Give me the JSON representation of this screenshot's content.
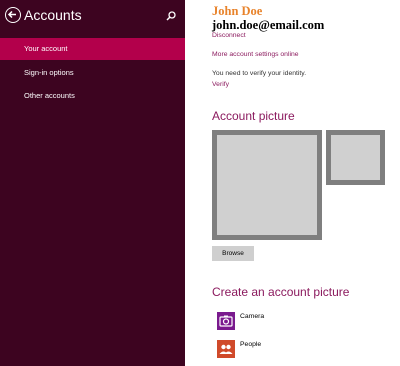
{
  "header": {
    "title": "Accounts"
  },
  "sidebar": {
    "items": [
      {
        "label": "Your account",
        "active": true
      },
      {
        "label": "Sign-in options",
        "active": false
      },
      {
        "label": "Other accounts",
        "active": false
      }
    ]
  },
  "account": {
    "name": "John Doe",
    "email": "john.doe@email.com",
    "disconnect_label": "Disconnect",
    "more_settings_label": "More account settings online",
    "verify_message": "You need to verify your identity.",
    "verify_label": "Verify"
  },
  "picture": {
    "title": "Account picture",
    "browse_label": "Browse"
  },
  "create": {
    "title": "Create an account picture",
    "apps": [
      {
        "label": "Camera",
        "icon": "camera-icon"
      },
      {
        "label": "People",
        "icon": "people-icon"
      }
    ]
  },
  "colors": {
    "sidebar_bg": "#3d0420",
    "active_item": "#b3004b",
    "accent": "#8b1a5e",
    "name": "#e8832b",
    "camera_tile": "#7a1a8e",
    "people_tile": "#d04a2a"
  }
}
